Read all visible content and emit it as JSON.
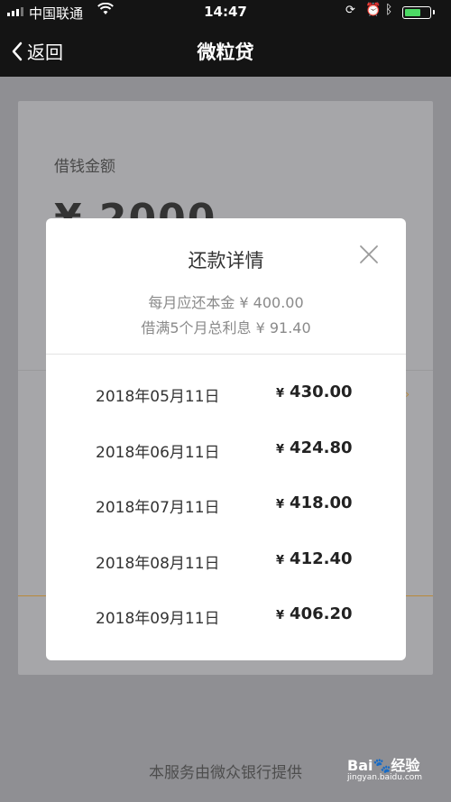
{
  "status_bar": {
    "carrier": "中国联通",
    "time": "14:47"
  },
  "nav": {
    "back_label": "返回",
    "title": "微粒贷"
  },
  "background_page": {
    "amount_label": "借钱金额",
    "amount_partial": "¥ 2000",
    "footer": "本服务由微众银行提供"
  },
  "watermark": {
    "brand": "Bai",
    "suffix": "经验",
    "url": "jingyan.baidu.com"
  },
  "modal": {
    "title": "还款详情",
    "monthly_principal": "每月应还本金 ¥ 400.00",
    "total_interest": "借满5个月总利息 ¥ 91.40",
    "currency": "¥",
    "rows": [
      {
        "date": "2018年05月11日",
        "amount": "430.00"
      },
      {
        "date": "2018年06月11日",
        "amount": "424.80"
      },
      {
        "date": "2018年07月11日",
        "amount": "418.00"
      },
      {
        "date": "2018年08月11日",
        "amount": "412.40"
      },
      {
        "date": "2018年09月11日",
        "amount": "406.20"
      }
    ]
  },
  "colors": {
    "accent": "#b9893a",
    "battery": "#4cd964"
  }
}
